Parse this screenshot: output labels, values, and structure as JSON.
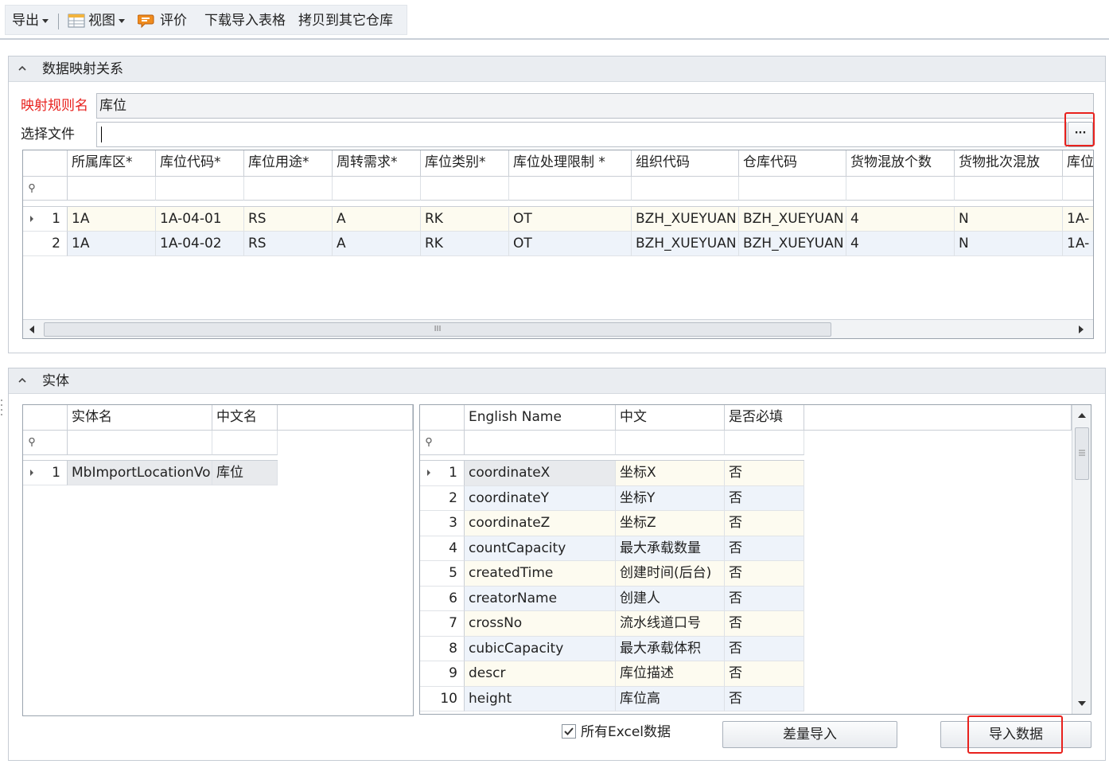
{
  "toolbar": {
    "export_label": "导出",
    "view_label": "视图",
    "rate_label": "评价",
    "download_label": "下载导入表格",
    "copy_label": "拷贝到其它仓库"
  },
  "mapping": {
    "title": "数据映射关系",
    "rule_label": "映射规则名",
    "rule_value": "库位",
    "file_label": "选择文件",
    "file_value": "",
    "browse_label": "···",
    "columns": [
      "所属库区*",
      "库位代码*",
      "库位用途*",
      "周转需求*",
      "库位类别*",
      "库位处理限制 *",
      "组织代码",
      "仓库代码",
      "货物混放个数",
      "货物批次混放",
      "库位"
    ],
    "rows": [
      {
        "index": "1",
        "cells": [
          "1A",
          "1A-04-01",
          "RS",
          "A",
          "RK",
          "OT",
          "BZH_XUEYUAN",
          "BZH_XUEYUAN",
          "4",
          "N",
          "1A-"
        ]
      },
      {
        "index": "2",
        "cells": [
          "1A",
          "1A-04-02",
          "RS",
          "A",
          "RK",
          "OT",
          "BZH_XUEYUAN",
          "BZH_XUEYUAN",
          "4",
          "N",
          "1A-"
        ]
      }
    ],
    "scroll_grip": "III"
  },
  "entity": {
    "title": "实体",
    "columns": [
      "实体名",
      "中文名"
    ],
    "rows": [
      {
        "index": "1",
        "name": "MbImportLocationVo",
        "cn": "库位"
      }
    ]
  },
  "fields": {
    "columns": [
      "English Name",
      "中文",
      "是否必填"
    ],
    "rows": [
      {
        "index": "1",
        "en": "coordinateX",
        "cn": "坐标X",
        "req": "否"
      },
      {
        "index": "2",
        "en": "coordinateY",
        "cn": "坐标Y",
        "req": "否"
      },
      {
        "index": "3",
        "en": "coordinateZ",
        "cn": "坐标Z",
        "req": "否"
      },
      {
        "index": "4",
        "en": "countCapacity",
        "cn": "最大承载数量",
        "req": "否"
      },
      {
        "index": "5",
        "en": "createdTime",
        "cn": "创建时间(后台)",
        "req": "否"
      },
      {
        "index": "6",
        "en": "creatorName",
        "cn": "创建人",
        "req": "否"
      },
      {
        "index": "7",
        "en": "crossNo",
        "cn": "流水线道口号",
        "req": "否"
      },
      {
        "index": "8",
        "en": "cubicCapacity",
        "cn": "最大承载体积",
        "req": "否"
      },
      {
        "index": "9",
        "en": "descr",
        "cn": "库位描述",
        "req": "否"
      },
      {
        "index": "10",
        "en": "height",
        "cn": "库位高",
        "req": "否"
      }
    ]
  },
  "footer": {
    "all_excel_label": "所有Excel数据",
    "all_excel_checked": true,
    "diff_import_label": "差量导入",
    "import_label": "导入数据"
  },
  "colors": {
    "required_label": "#e8211d",
    "highlight_box": "#e8211d"
  }
}
